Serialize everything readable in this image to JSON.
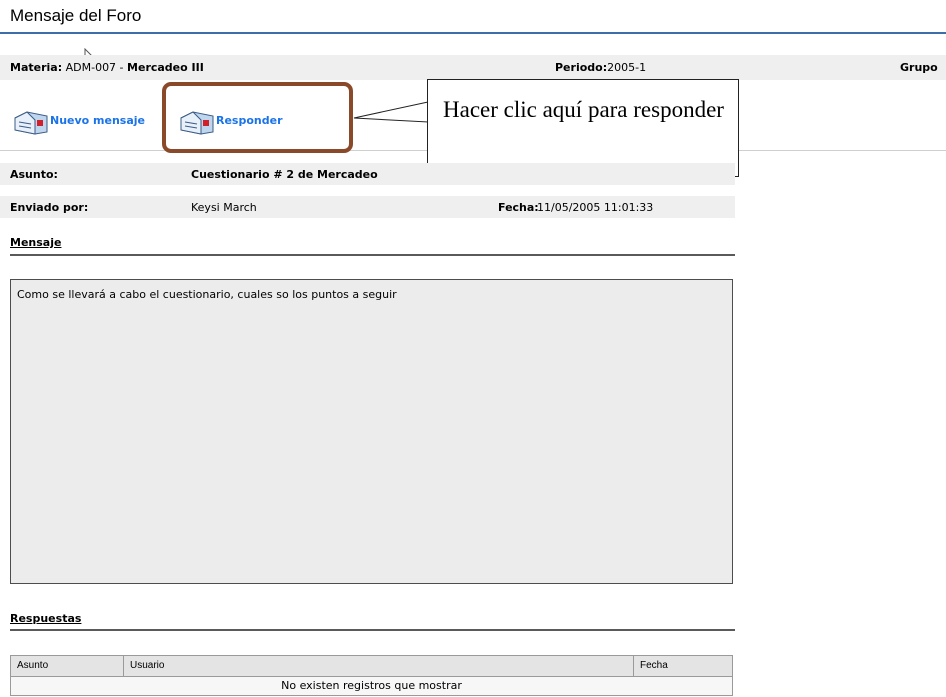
{
  "page": {
    "title": "Mensaje del Foro"
  },
  "info": {
    "materia_label": "Materia:",
    "materia_code": "ADM-007 - ",
    "materia_name": "Mercadeo III",
    "periodo_label": "Periodo:",
    "periodo_value": "2005-1",
    "grupo_label": "Grupo"
  },
  "toolbar": {
    "new_message": "Nuevo mensaje",
    "reply": "Responder"
  },
  "callout": {
    "text": "Hacer clic aquí para responder"
  },
  "message": {
    "subject_label": "Asunto:",
    "subject_value": "Cuestionario # 2 de Mercadeo",
    "sender_label": "Enviado por:",
    "sender_value": "Keysi March",
    "date_label": "Fecha:",
    "date_value": "11/05/2005 11:01:33",
    "section_title": "Mensaje",
    "body": "Como se llevará a cabo el cuestionario, cuales so los puntos a seguir"
  },
  "replies": {
    "section_title": "Respuestas",
    "columns": [
      "Asunto",
      "Usuario",
      "Fecha"
    ],
    "empty_text": "No existen registros que mostrar"
  },
  "colors": {
    "link": "#1a73e8",
    "highlight": "#8a4a2a",
    "title_rule": "#3d6fa6"
  }
}
